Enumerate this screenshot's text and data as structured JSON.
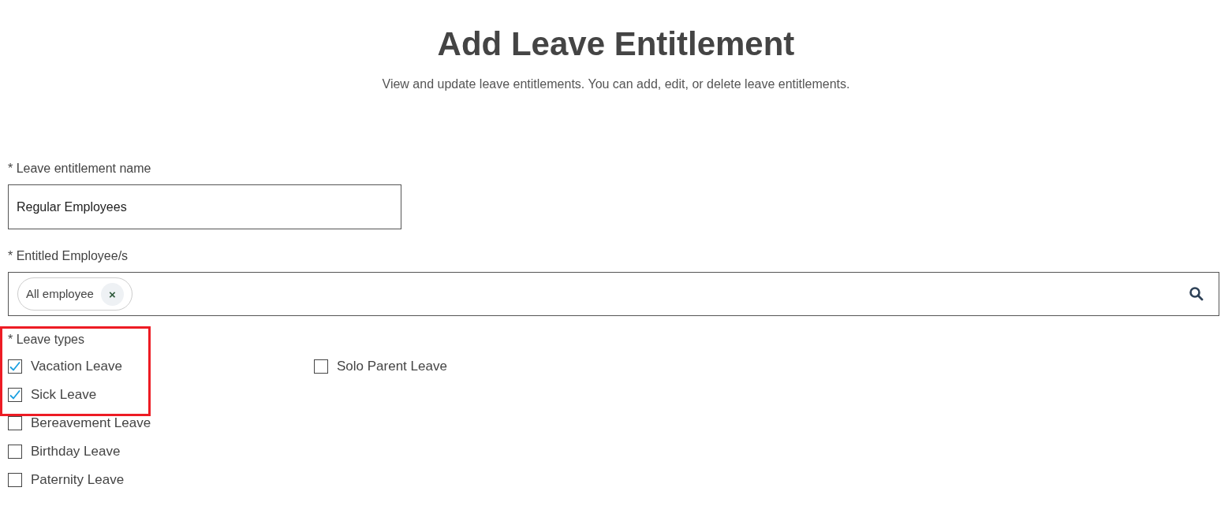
{
  "header": {
    "title": "Add Leave Entitlement",
    "subtitle": "View and update leave entitlements. You can add, edit, or delete leave entitlements."
  },
  "entitlement_name": {
    "label": "* Leave entitlement name",
    "value": "Regular Employees"
  },
  "entitled_employees": {
    "label": "* Entitled Employee/s",
    "chips": [
      {
        "label": "All employee",
        "remove": "×"
      }
    ]
  },
  "leave_types": {
    "label": "* Leave types",
    "highlighted": true,
    "items": [
      {
        "label": "Vacation Leave",
        "checked": true
      },
      {
        "label": "Sick Leave",
        "checked": true
      },
      {
        "label": "Bereavement Leave",
        "checked": false
      },
      {
        "label": "Birthday Leave",
        "checked": false
      },
      {
        "label": "Paternity Leave",
        "checked": false
      },
      {
        "label": "Solo Parent Leave",
        "checked": false
      }
    ]
  }
}
